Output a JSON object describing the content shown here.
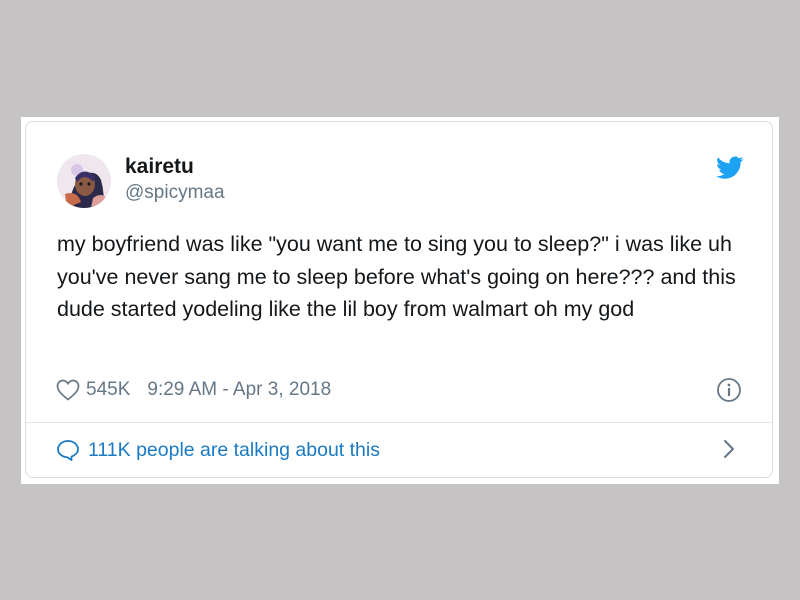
{
  "tweet": {
    "display_name": "kairetu",
    "handle": "@spicymaa",
    "text": "my boyfriend was like \"you want me to sing you to sleep?\" i was like uh you've never sang me to sleep before what's going on here??? and this dude started yodeling like the lil boy from walmart oh my god",
    "likes": "545K",
    "timestamp": "9:29 AM - Apr 3, 2018",
    "talking_text": "111K people are talking about this"
  },
  "icons": {
    "avatar": "avatar-image",
    "brand": "twitter-bird-icon",
    "like": "heart-icon",
    "info": "info-icon",
    "reply": "speech-bubble-icon",
    "chevron": "chevron-right-icon"
  },
  "colors": {
    "background": "#c5c3c3",
    "card": "#ffffff",
    "text_primary": "#14171a",
    "text_secondary": "#657786",
    "link": "#1b7ac4",
    "twitter_blue": "#1da1f2"
  }
}
